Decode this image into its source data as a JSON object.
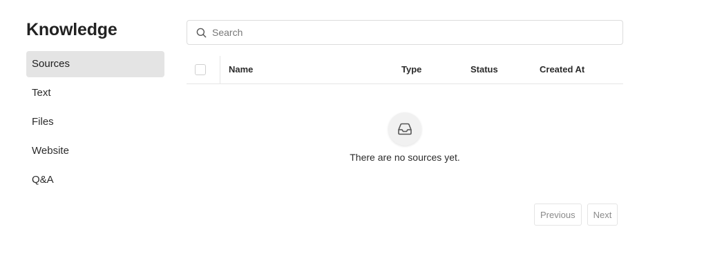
{
  "sidebar": {
    "title": "Knowledge",
    "items": [
      {
        "label": "Sources",
        "active": true
      },
      {
        "label": "Text",
        "active": false
      },
      {
        "label": "Files",
        "active": false
      },
      {
        "label": "Website",
        "active": false
      },
      {
        "label": "Q&A",
        "active": false
      }
    ]
  },
  "search": {
    "placeholder": "Search",
    "value": "",
    "icon": "search-icon"
  },
  "table": {
    "columns": [
      "Name",
      "Type",
      "Status",
      "Created At"
    ],
    "rows": []
  },
  "empty_state": {
    "icon": "inbox-icon",
    "message": "There are no sources yet."
  },
  "pagination": {
    "previous_label": "Previous",
    "next_label": "Next"
  },
  "colors": {
    "active_nav_bg": "#e4e4e4",
    "border": "#dcdcdc",
    "muted_text": "#8a8a8a"
  }
}
